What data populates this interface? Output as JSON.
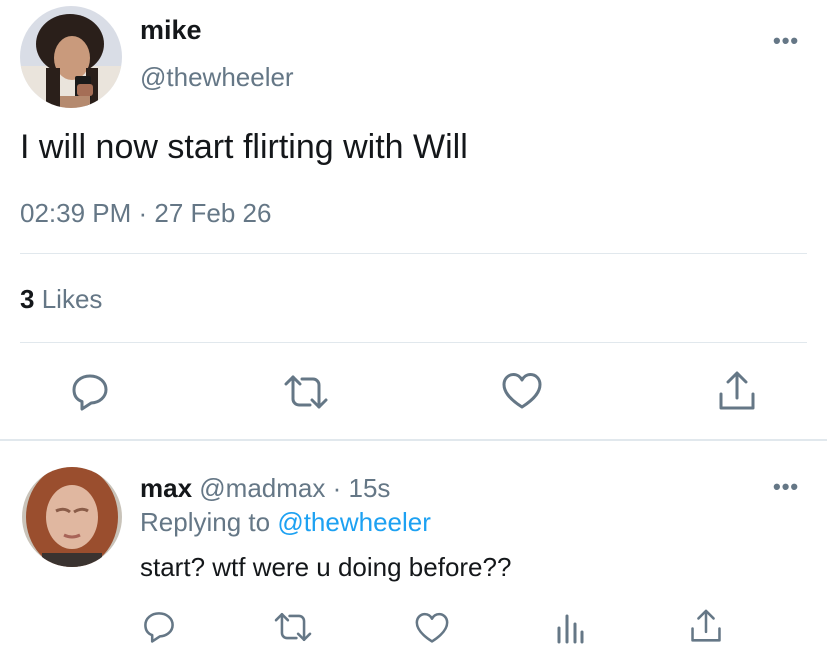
{
  "tweet": {
    "author_name": "mike",
    "author_handle": "@thewheeler",
    "text": "I will now start flirting with Will",
    "timestamp": "02:39 PM · 27 Feb 26",
    "likes_count": "3",
    "likes_label": "Likes",
    "more_label": "•••"
  },
  "reply": {
    "author_name": "max",
    "author_handle": "@madmax",
    "time": "· 15s",
    "replying_prefix": "Replying to",
    "replying_to": "@thewheeler",
    "text": "start? wtf were u doing before??",
    "more_label": "•••"
  },
  "colors": {
    "accent": "#1da1f2",
    "secondary_text": "#657786",
    "divider": "#e1e8ed"
  },
  "icons": [
    "reply-icon",
    "retweet-icon",
    "like-icon",
    "analytics-icon",
    "share-icon"
  ]
}
